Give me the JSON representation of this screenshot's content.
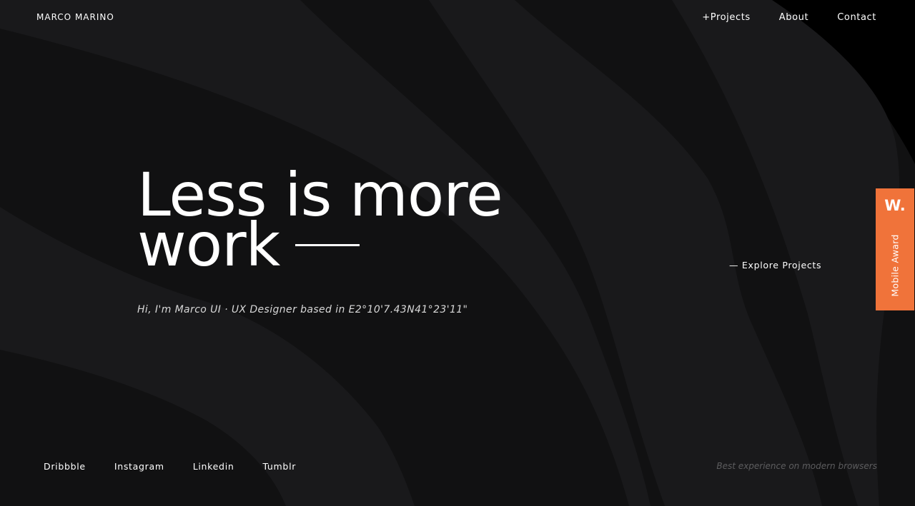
{
  "brand": {
    "name": "MARCO MARINO"
  },
  "nav": {
    "items": [
      "+Projects",
      "About",
      "Contact"
    ]
  },
  "hero": {
    "title_line1": "Less is more",
    "title_line2": "work",
    "subtitle": "Hi, I'm Marco UI · UX Designer based in E2°10'7.43N41°23'11\"",
    "explore_label": "— Explore Projects"
  },
  "award": {
    "logo": "W.",
    "label": "Mobile Award",
    "color": "#f0733a"
  },
  "social": {
    "links": [
      "Dribbble",
      "Instagram",
      "Linkedin",
      "Tumblr"
    ]
  },
  "footer": {
    "note": "Best experience on modern browsers"
  },
  "colors": {
    "background": "#111112",
    "wave_light": "#19191b",
    "corner": "#000000",
    "text": "#ffffff"
  }
}
